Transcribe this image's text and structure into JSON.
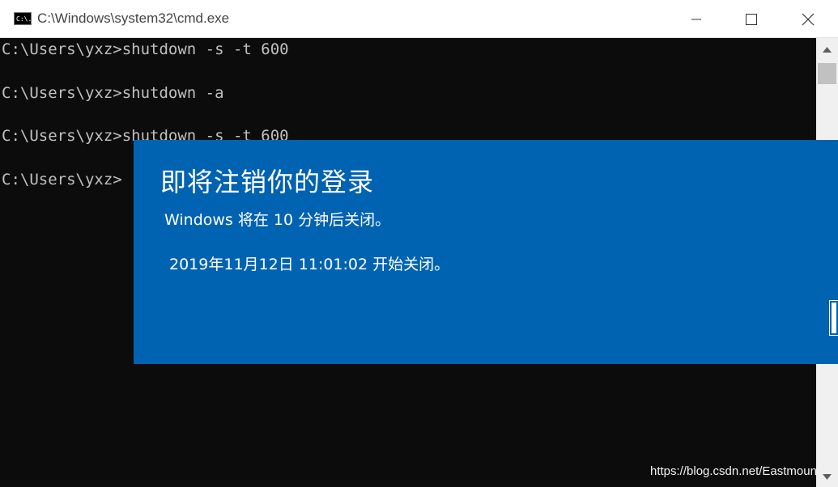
{
  "window": {
    "title": "C:\\Windows\\system32\\cmd.exe",
    "icon_text": "C:\\."
  },
  "console": {
    "lines": [
      "C:\\Users\\yxz>shutdown -s -t 600",
      "",
      "C:\\Users\\yxz>shutdown -a",
      "",
      "C:\\Users\\yxz>shutdown -s -t 600",
      "",
      "C:\\Users\\yxz>"
    ]
  },
  "notification": {
    "title": "即将注销你的登录",
    "message": "Windows 将在 10 分钟后关闭。",
    "time": "2019年11月12日 11:01:02 开始关闭。",
    "background_color": "#0063b1"
  },
  "watermark": "https://blog.csdn.net/Eastmount",
  "icons": {
    "app": "cmd-app-icon",
    "minimize": "minimize-icon",
    "maximize": "maximize-icon",
    "close": "close-icon",
    "scroll_up": "scroll-up-arrow-icon",
    "scroll_down": "scroll-down-arrow-icon"
  }
}
